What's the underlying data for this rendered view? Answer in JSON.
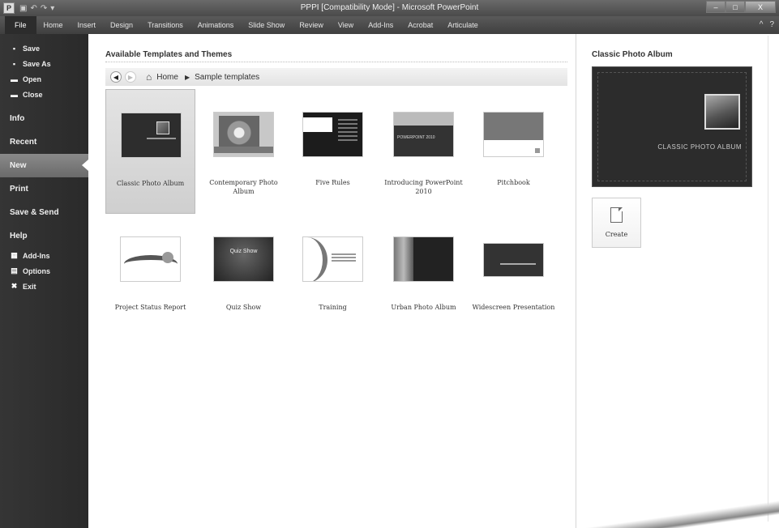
{
  "window": {
    "title": "PPPI [Compatibility Mode] - Microsoft PowerPoint",
    "app_icon": "P",
    "controls": [
      "–",
      "□",
      "X"
    ]
  },
  "ribbon": {
    "tabs": [
      "File",
      "Home",
      "Insert",
      "Design",
      "Transitions",
      "Animations",
      "Slide Show",
      "Review",
      "View",
      "Add-Ins",
      "Acrobat",
      "Articulate"
    ],
    "help": "?",
    "minimize_ribbon": "^"
  },
  "sidebar": {
    "commands": [
      {
        "label": "Save",
        "icon": "save-icon"
      },
      {
        "label": "Save As",
        "icon": "save-as-icon"
      },
      {
        "label": "Open",
        "icon": "folder-open-icon"
      },
      {
        "label": "Close",
        "icon": "folder-close-icon"
      }
    ],
    "tabs": [
      "Info",
      "Recent",
      "New",
      "Print",
      "Save & Send",
      "Help"
    ],
    "active_tab": "New",
    "footer": [
      {
        "label": "Add-Ins",
        "icon": "add-ins-icon"
      },
      {
        "label": "Options",
        "icon": "options-icon"
      },
      {
        "label": "Exit",
        "icon": "exit-icon"
      }
    ]
  },
  "main": {
    "section_title": "Available Templates and Themes",
    "breadcrumb": [
      "Home",
      "Sample templates"
    ],
    "templates": [
      {
        "label": "Classic Photo Album",
        "selected": true
      },
      {
        "label": "Contemporary Photo Album"
      },
      {
        "label": "Five Rules"
      },
      {
        "label": "Introducing PowerPoint 2010"
      },
      {
        "label": "Pitchbook"
      },
      {
        "label": "Project Status Report"
      },
      {
        "label": "Quiz Show"
      },
      {
        "label": "Training"
      },
      {
        "label": "Urban Photo Album"
      },
      {
        "label": "Widescreen Presentation"
      }
    ],
    "thumb_text": {
      "intro": "POWERPOINT 2010",
      "quiz": "Quiz Show"
    }
  },
  "preview": {
    "title": "Classic Photo Album",
    "caption": "CLASSIC PHOTO ALBUM",
    "create_label": "Create"
  }
}
